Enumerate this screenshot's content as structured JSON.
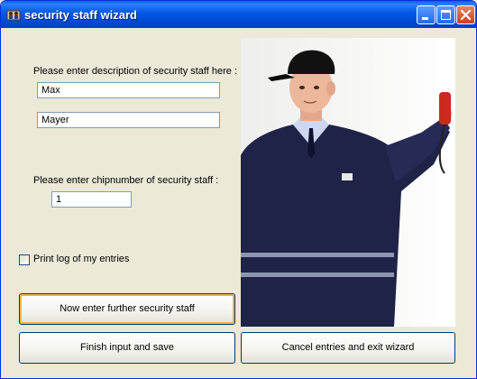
{
  "window": {
    "title": "security staff wizard"
  },
  "form": {
    "description_label": "Please enter description of security staff here :",
    "first_name_value": "Max",
    "last_name_value": "Mayer",
    "chip_label": "Please enter chipnumber of security staff :",
    "chip_value": "1",
    "print_log_label": "Print log of my entries",
    "print_log_checked": false
  },
  "buttons": {
    "further": "Now enter further security staff",
    "finish": "Finish input and save",
    "cancel": "Cancel entries and exit wizard"
  },
  "colors": {
    "titlebar": "#0058e6",
    "dialog_bg": "#ece9d8",
    "focus_ring": "#f8b33a",
    "close_button": "#c8401f"
  },
  "icons": [
    "app-icon",
    "minimize-icon",
    "maximize-icon",
    "close-icon"
  ]
}
